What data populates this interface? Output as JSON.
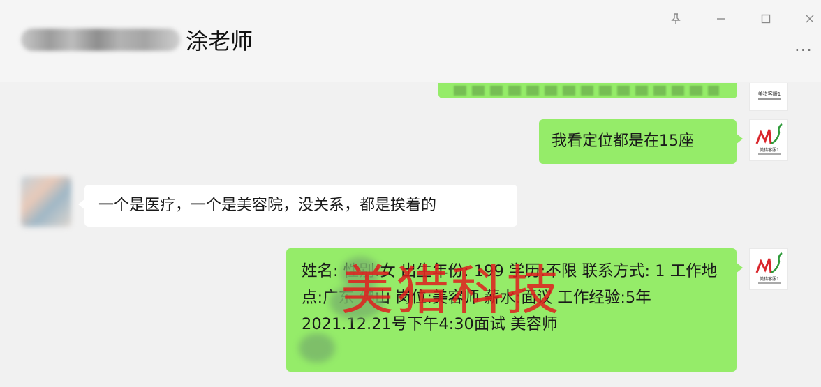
{
  "window": {
    "title": "涂老师",
    "controls": [
      "pin-icon",
      "minimize-icon",
      "maximize-icon",
      "close-icon"
    ],
    "more_label": "···"
  },
  "messages": [
    {
      "from": "me",
      "text": ""
    },
    {
      "from": "me",
      "text": "我看定位都是在15座"
    },
    {
      "from": "other",
      "text": "一个是医疗，一个是美容院，没关系，都是挨着的"
    },
    {
      "from": "me",
      "text": "姓名:  性别:女 出生年份: 199  学历:不限 联系方式: 1  工作地点:广东 佛山 岗位:美容师 薪水:面议 工作经验:5年 2021.12.21号下午4:30面试  美容师"
    }
  ],
  "watermark": "美猎科技",
  "colors": {
    "my_bubble": "#95ec69",
    "other_bubble": "#ffffff",
    "background": "#f1f1f1",
    "watermark": "#e01e1e"
  }
}
